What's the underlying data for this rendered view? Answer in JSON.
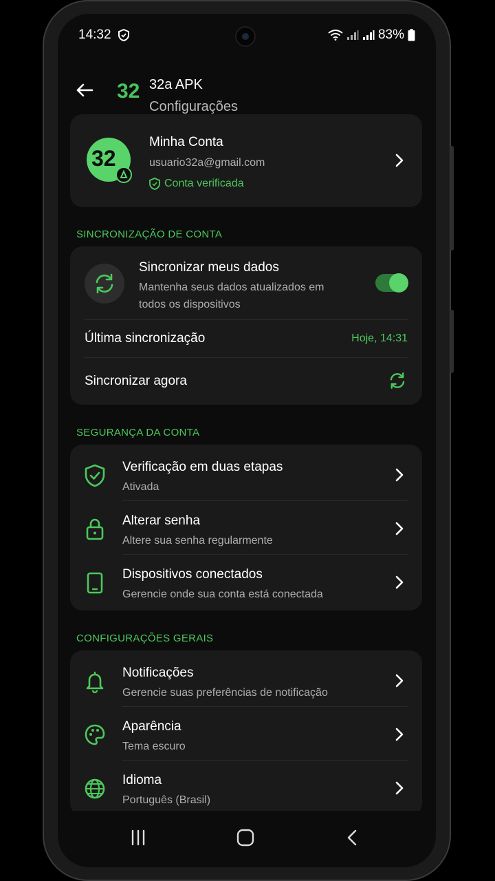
{
  "status_bar": {
    "time": "14:32",
    "battery": "83%"
  },
  "header": {
    "logo": "32",
    "title": "32a APK",
    "subtitle": "Configurações"
  },
  "account": {
    "avatar_text": "32",
    "name": "Minha Conta",
    "email": "usuario32a@gmail.com",
    "verified": "Conta verificada"
  },
  "sync_section": {
    "title": "SINCRONIZAÇÃO DE CONTA",
    "sync_title": "Sincronizar meus dados",
    "sync_desc": "Mantenha seus dados atualizados em todos os dispositivos",
    "toggle_on": true,
    "last_sync_label": "Última sincronização",
    "last_sync_value": "Hoje, 14:31",
    "sync_now_label": "Sincronizar agora"
  },
  "security_section": {
    "title": "SEGURANÇA DA CONTA",
    "items": [
      {
        "title": "Verificação em duas etapas",
        "subtitle": "Ativada",
        "icon": "shield-check-icon"
      },
      {
        "title": "Alterar senha",
        "subtitle": "Altere sua senha regularmente",
        "icon": "lock-icon"
      },
      {
        "title": "Dispositivos conectados",
        "subtitle": "Gerencie onde sua conta está conectada",
        "icon": "tablet-icon"
      }
    ]
  },
  "general_section": {
    "title": "CONFIGURAÇÕES GERAIS",
    "items": [
      {
        "title": "Notificações",
        "subtitle": "Gerencie suas preferências de notificação",
        "icon": "bell-icon"
      },
      {
        "title": "Aparência",
        "subtitle": "Tema escuro",
        "icon": "palette-icon"
      },
      {
        "title": "Idioma",
        "subtitle": "Português (Brasil)",
        "icon": "globe-icon"
      }
    ]
  },
  "colors": {
    "accent": "#4cc85c",
    "background": "#0c0c0c",
    "card": "#1a1a1a"
  }
}
